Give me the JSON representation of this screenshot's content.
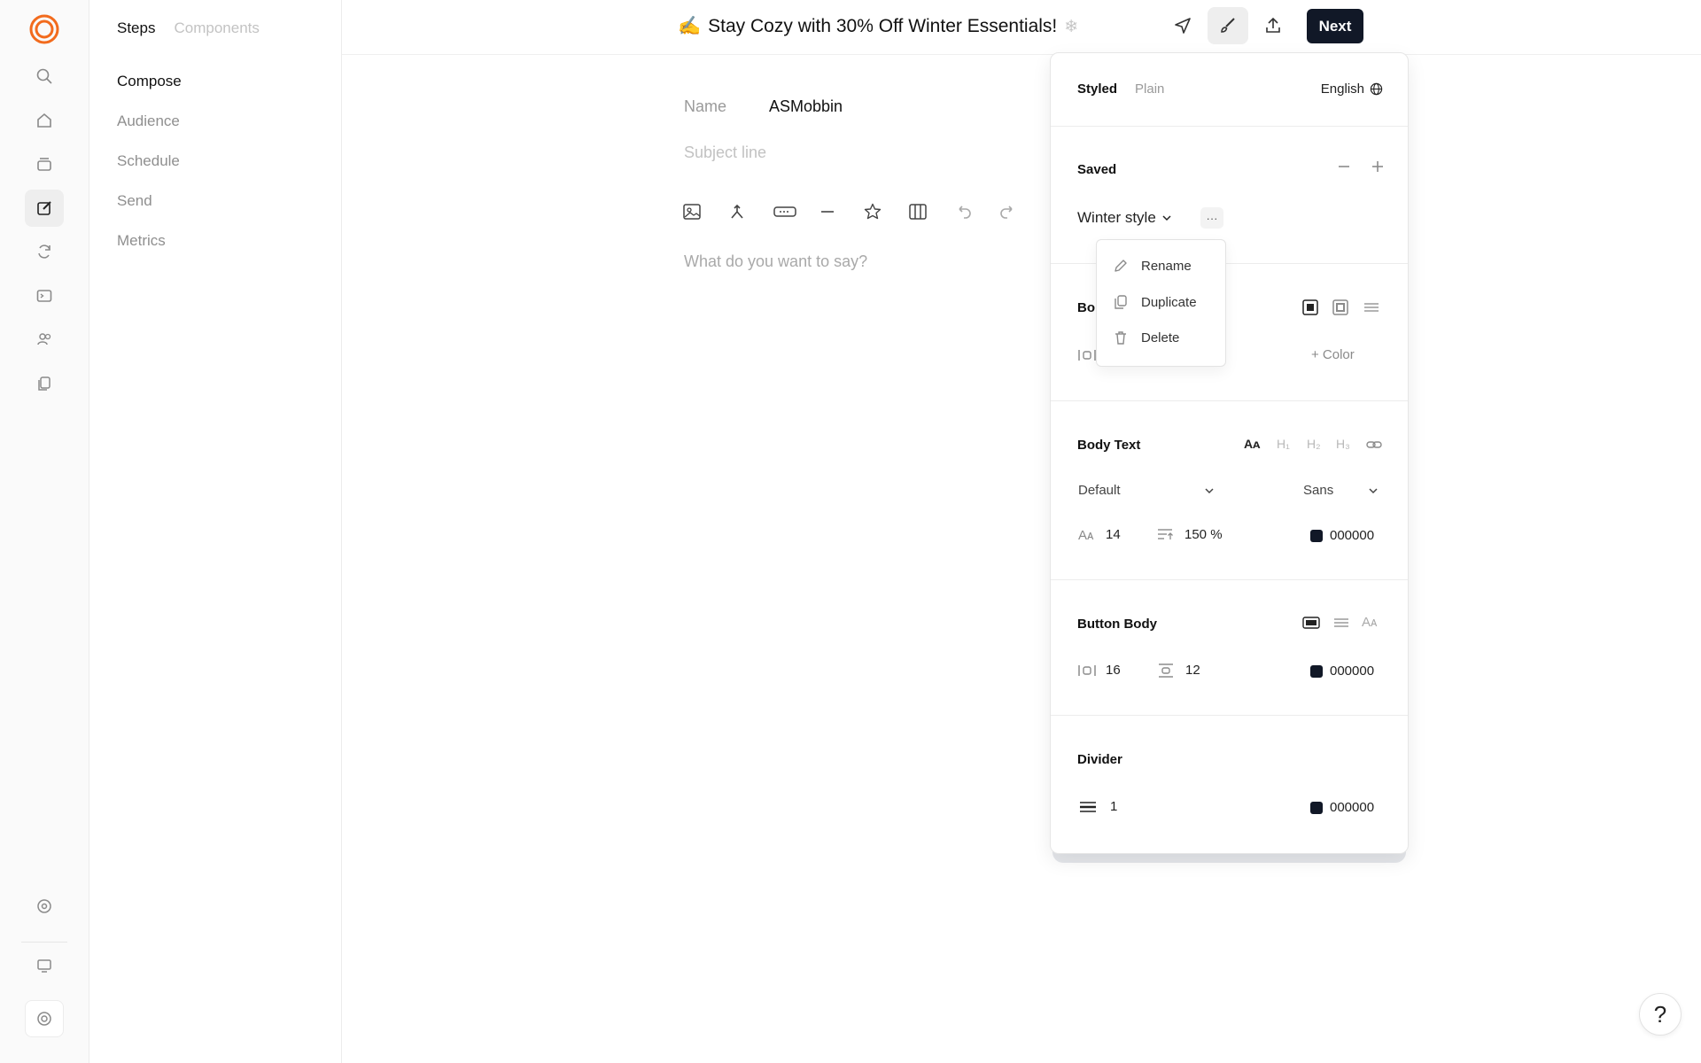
{
  "header": {
    "title_emoji": "✍️",
    "title": "Stay Cozy with 30% Off Winter Essentials!",
    "title_trailing": "❄",
    "next_label": "Next"
  },
  "steps": {
    "tabs": [
      "Steps",
      "Components"
    ],
    "items": [
      "Compose",
      "Audience",
      "Schedule",
      "Send",
      "Metrics"
    ]
  },
  "compose": {
    "name_label": "Name",
    "name_value": "ASMobbin",
    "subject_placeholder": "Subject line",
    "body_placeholder": "What do you want to say?"
  },
  "panel": {
    "tabs": [
      "Styled",
      "Plain"
    ],
    "language": "English",
    "saved_title": "Saved",
    "saved_style": "Winter style",
    "more_label": "···",
    "body_section_title_partial": "Bo",
    "color_label": "+ Color",
    "body_text": {
      "title": "Body Text",
      "style_select": "Default",
      "font_select": "Sans",
      "font_size": "14",
      "line_height": "150 %",
      "color": "000000"
    },
    "button_body": {
      "title": "Button Body",
      "padding_h": "16",
      "padding_v": "12",
      "color": "000000"
    },
    "divider": {
      "title": "Divider",
      "thickness": "1",
      "color": "000000"
    }
  },
  "menu": {
    "items": [
      "Rename",
      "Duplicate",
      "Delete"
    ]
  },
  "help_label": "?",
  "colors": {
    "accent": "#f26b1d",
    "primary_dark": "#111827"
  }
}
